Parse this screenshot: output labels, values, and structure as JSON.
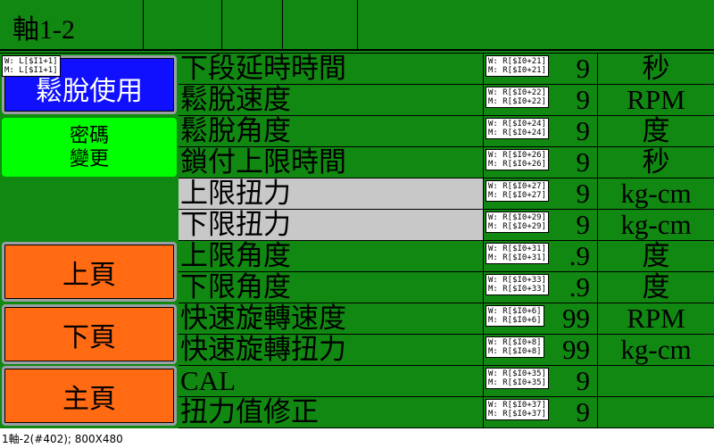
{
  "header": {
    "title": "軸1-2"
  },
  "left": {
    "loosen_button": {
      "label": "鬆脫使用",
      "tag": "W: L[$I1+1]\nM: L[$I1+1]"
    },
    "password_button": {
      "label": "密碼\n變更"
    },
    "prev_page": {
      "label": "上頁"
    },
    "next_page": {
      "label": "下頁"
    },
    "main_page": {
      "label": "主頁"
    }
  },
  "rows": [
    {
      "label": "下段延時時間",
      "tag": "W: R[$I0+21]\nM: R[$I0+21]",
      "value": "9",
      "unit": "秒"
    },
    {
      "label": "鬆脫速度",
      "tag": "W: R[$I0+22]\nM: R[$I0+22]",
      "value": "9",
      "unit": "RPM"
    },
    {
      "label": "鬆脫角度",
      "tag": "W: R[$I0+24]\nM: R[$I0+24]",
      "value": "9",
      "unit": "度"
    },
    {
      "label": "鎖付上限時間",
      "tag": "W: R[$I0+26]\nM: R[$I0+26]",
      "value": "9",
      "unit": "秒"
    },
    {
      "label": "上限扭力",
      "tag": "W: R[$I0+27]\nM: R[$I0+27]",
      "value": "9",
      "unit": "kg-cm"
    },
    {
      "label": "下限扭力",
      "tag": "W: R[$I0+29]\nM: R[$I0+29]",
      "value": "9",
      "unit": "kg-cm"
    },
    {
      "label": "上限角度",
      "tag": "W: R[$I0+31]\nM: R[$I0+31]",
      "value": ".9",
      "unit": "度"
    },
    {
      "label": "下限角度",
      "tag": "W: R[$I0+33]\nM: R[$I0+33]",
      "value": ".9",
      "unit": "度"
    },
    {
      "label": "快速旋轉速度",
      "tag": "W: R[$I0+6]\nM: R[$I0+6]",
      "value": "99",
      "unit": "RPM"
    },
    {
      "label": "快速旋轉扭力",
      "tag": "W: R[$I0+8]\nM: R[$I0+8]",
      "value": "99",
      "unit": "kg-cm"
    },
    {
      "label": "CAL",
      "tag": "W: R[$I0+35]\nM: R[$I0+35]",
      "value": "9",
      "unit": ""
    },
    {
      "label": "扭力值修正",
      "tag": "W: R[$I0+37]\nM: R[$I0+37]",
      "value": "9",
      "unit": ""
    }
  ],
  "status_bar": {
    "text": "1軸-2(#402); 800X480"
  }
}
